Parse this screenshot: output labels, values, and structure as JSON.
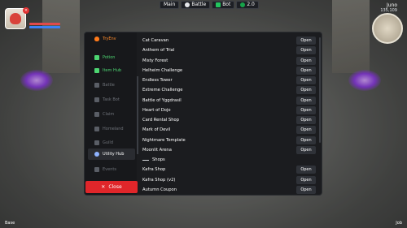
{
  "hud": {
    "chips": [
      {
        "label": "Main",
        "color": "#6b7280"
      },
      {
        "label": "Battle",
        "color": "#e5e7eb"
      },
      {
        "label": "Bot",
        "color": "#22c55e"
      },
      {
        "label": "2.0",
        "color": "#16a34a"
      }
    ],
    "player_name": "Juno",
    "player_sub": "135,109"
  },
  "bottom": {
    "left": "Base",
    "right": "Job"
  },
  "sidebar": {
    "items": [
      {
        "label": "TryEnv",
        "icon": "flame-icon",
        "state": "orange"
      },
      {
        "label": "Potion",
        "icon": "potion-icon",
        "state": "green"
      },
      {
        "label": "Item Hub",
        "icon": "item-hub-icon",
        "state": "green"
      },
      {
        "label": "Battle",
        "icon": "battle-icon",
        "state": "dim"
      },
      {
        "label": "Task Bot",
        "icon": "task-bot-icon",
        "state": "dim"
      },
      {
        "label": "Claim",
        "icon": "claim-icon",
        "state": "dim"
      },
      {
        "label": "Homeland",
        "icon": "home-icon",
        "state": "dim"
      },
      {
        "label": "Guild",
        "icon": "guild-icon",
        "state": "dim"
      },
      {
        "label": "Utility Hub",
        "icon": "globe-icon",
        "state": "active"
      },
      {
        "label": "Events",
        "icon": "trophy-icon",
        "state": "dim"
      }
    ],
    "close_label": "Close"
  },
  "list": {
    "open_label": "Open",
    "rows": [
      "Cat Caravan",
      "Anthem of Trial",
      "Misty Forest",
      "Helheim Challenge",
      "Endless Tower",
      "Extreme Challenge",
      "Battle of Yggdrasil",
      "Heart of Dojo",
      "Card Rental Shop",
      "Mark of Devil",
      "Nightmare Template",
      "Moonlit Arena"
    ],
    "section_title": "Shops",
    "shop_rows": [
      "Kafra Shop",
      "Kafra Shop (v2)",
      "Autumn Coupon"
    ]
  }
}
